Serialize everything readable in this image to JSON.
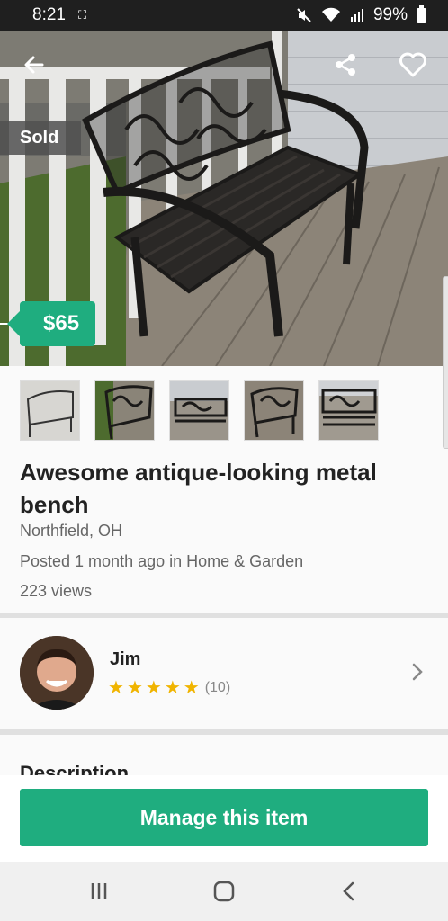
{
  "status_bar": {
    "time": "8:21",
    "notif_glyph": "⛶",
    "battery": "99%",
    "icons": [
      "mute-icon",
      "wifi-icon",
      "signal-icon",
      "battery-icon"
    ]
  },
  "hero": {
    "sold_label": "Sold",
    "price": "$65",
    "actions": [
      "back-arrow-icon",
      "share-icon",
      "heart-icon"
    ]
  },
  "listing": {
    "thumbnail_count": 5,
    "title": "Awesome antique-looking metal bench",
    "location": "Northfield, OH",
    "posted": "Posted 1 month ago in Home & Garden",
    "views": "223 views"
  },
  "seller": {
    "name": "Jim",
    "rating_stars": 5,
    "rating_count": "(10)"
  },
  "description": {
    "heading": "Description"
  },
  "action": {
    "manage_label": "Manage this item"
  },
  "colors": {
    "accent": "#1fad7f",
    "star": "#f0b400",
    "sold_badge": "#505050"
  }
}
